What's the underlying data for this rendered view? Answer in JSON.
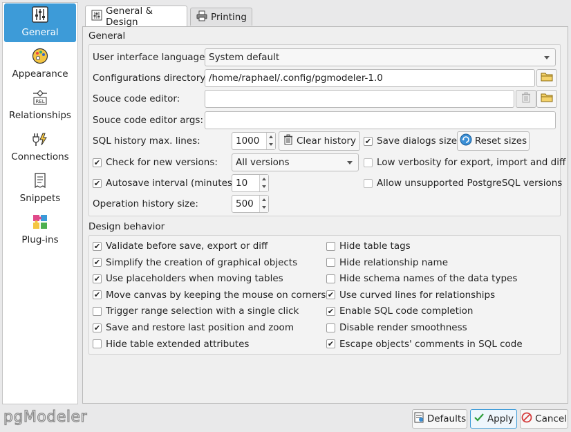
{
  "sidebar": {
    "items": [
      {
        "label": "General",
        "icon": "sliders-icon"
      },
      {
        "label": "Appearance",
        "icon": "palette-icon"
      },
      {
        "label": "Relationships",
        "icon": "relationship-icon"
      },
      {
        "label": "Connections",
        "icon": "plug-icon"
      },
      {
        "label": "Snippets",
        "icon": "snippet-icon"
      },
      {
        "label": "Plug-ins",
        "icon": "puzzle-icon"
      }
    ],
    "selected_color": "#3d9bd8"
  },
  "tabs": [
    {
      "label": "General & Design",
      "icon": "settings-icon"
    },
    {
      "label": "Printing",
      "icon": "printer-icon"
    }
  ],
  "general": {
    "title": "General",
    "ui_language_label": "User interface language:",
    "ui_language_value": "System default",
    "config_dir_label": "Configurations directory:",
    "config_dir_value": "/home/raphael/.config/pgmodeler-1.0",
    "source_editor_label": "Souce code editor:",
    "source_editor_value": "",
    "source_editor_args_label": "Souce code editor args:",
    "source_editor_args_value": "",
    "sql_history_label": "SQL history max. lines:",
    "sql_history_value": "1000",
    "clear_history_label": "Clear history",
    "save_dialogs_label": "Save dialogs sizes",
    "save_dialogs_checked": true,
    "reset_sizes_label": "Reset sizes",
    "check_versions_label": "Check for new versions:",
    "check_versions_checked": true,
    "versions_value": "All versions",
    "low_verbosity_label": "Low verbosity for export, import and diff",
    "low_verbosity_checked": false,
    "autosave_label": "Autosave interval (minutes):",
    "autosave_checked": true,
    "autosave_value": "10",
    "allow_unsupported_label": "Allow unsupported PostgreSQL versions",
    "allow_unsupported_checked": false,
    "op_history_label": "Operation history size:",
    "op_history_value": "500"
  },
  "design": {
    "title": "Design behavior",
    "left": [
      {
        "label": "Validate before save, export or diff",
        "checked": true
      },
      {
        "label": "Simplify the creation of graphical objects",
        "checked": true
      },
      {
        "label": "Use placeholders when moving tables",
        "checked": true
      },
      {
        "label": "Move canvas by keeping the mouse on corners",
        "checked": true
      },
      {
        "label": "Trigger range selection with a single click",
        "checked": false
      },
      {
        "label": "Save and restore last position and zoom",
        "checked": true
      },
      {
        "label": "Hide table extended attributes",
        "checked": false
      }
    ],
    "right": [
      {
        "label": "Hide table tags",
        "checked": false
      },
      {
        "label": "Hide relationship name",
        "checked": false
      },
      {
        "label": "Hide schema names of the data types",
        "checked": false
      },
      {
        "label": "Use curved lines for relationships",
        "checked": true
      },
      {
        "label": "Enable SQL code completion",
        "checked": true
      },
      {
        "label": "Disable render smoothness",
        "checked": false
      },
      {
        "label": "Escape objects' comments in SQL code",
        "checked": true
      }
    ]
  },
  "footer": {
    "logo": "pgModeler",
    "defaults_label": "Defaults",
    "apply_label": "Apply",
    "cancel_label": "Cancel"
  }
}
